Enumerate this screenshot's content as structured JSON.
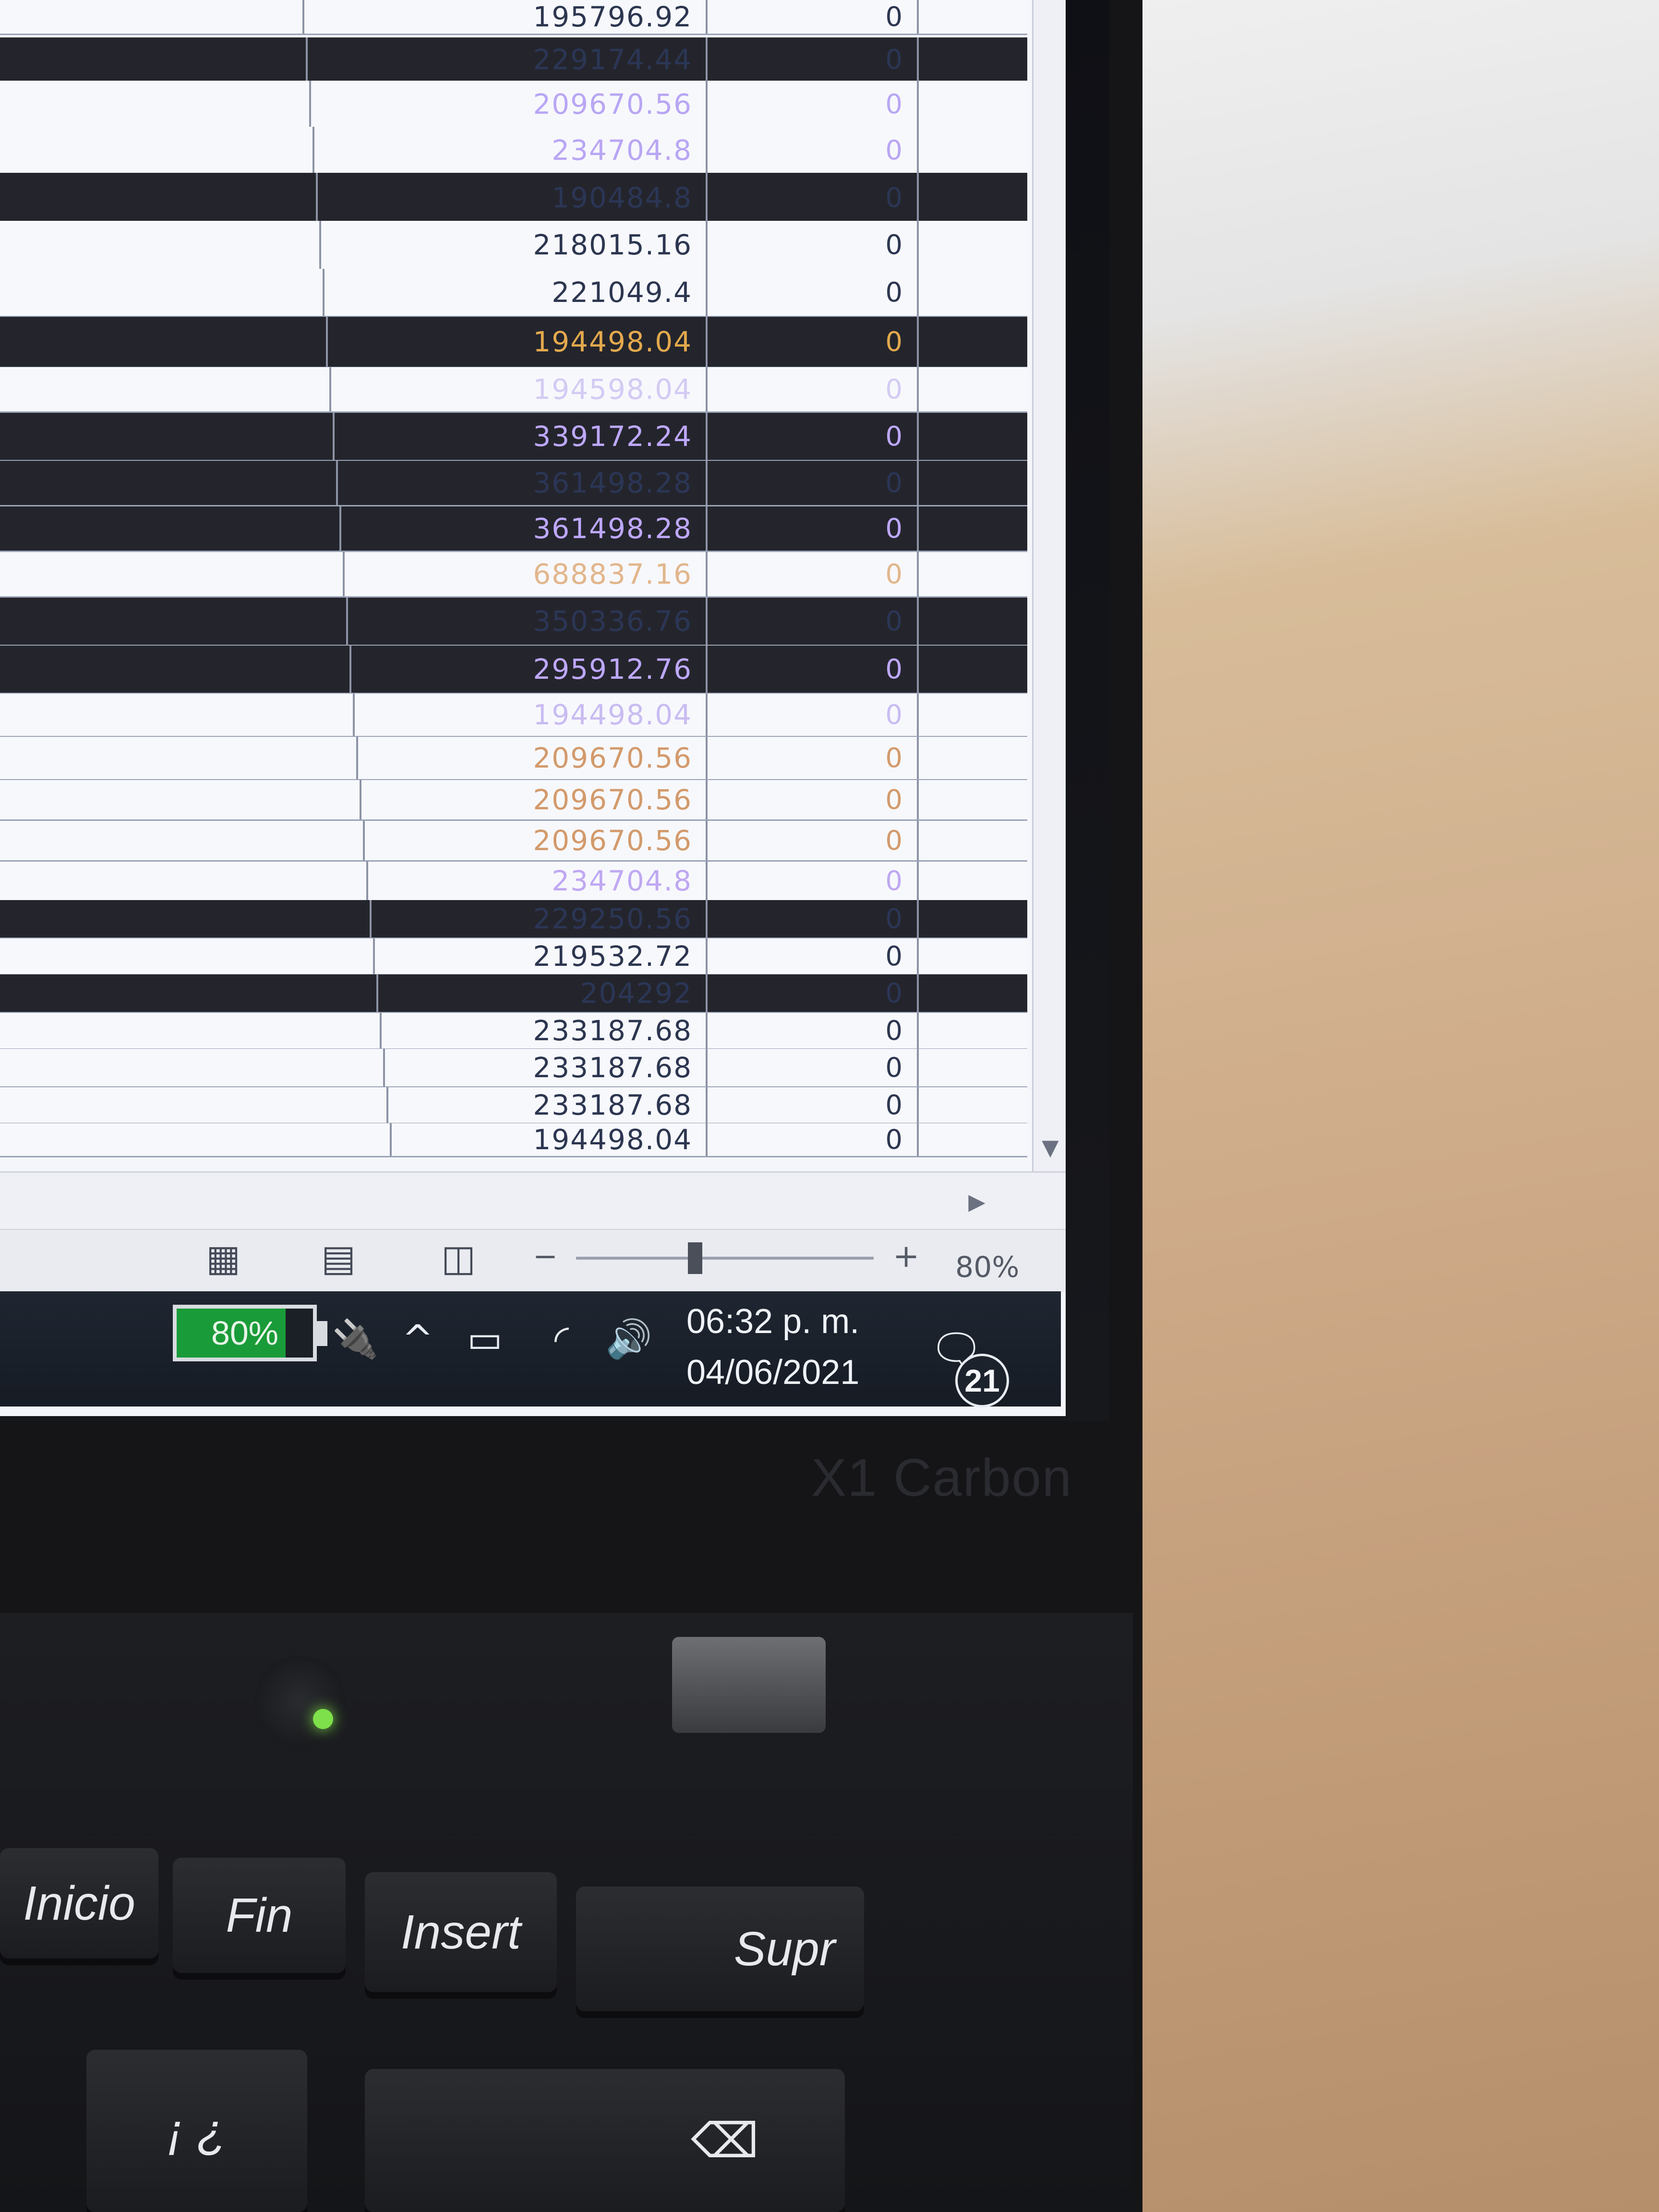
{
  "spreadsheet": {
    "rows": [
      {
        "amount": "195796.92",
        "value": "0",
        "theme": "light",
        "color": "#2c3650"
      },
      {
        "amount": "229174.44",
        "value": "0",
        "theme": "dark",
        "color": "#2b3656"
      },
      {
        "amount": "209670.56",
        "value": "0",
        "theme": "light",
        "color": "#b9a6f4"
      },
      {
        "amount": "234704.8",
        "value": "0",
        "theme": "light",
        "color": "#b9a6f4"
      },
      {
        "amount": "190484.8",
        "value": "0",
        "theme": "dark",
        "color": "#2b3656"
      },
      {
        "amount": "218015.16",
        "value": "0",
        "theme": "light",
        "color": "#2c3650"
      },
      {
        "amount": "221049.4",
        "value": "0",
        "theme": "light",
        "color": "#2c3650"
      },
      {
        "amount": "194498.04",
        "value": "0",
        "theme": "dark",
        "color": "#e3a94d"
      },
      {
        "amount": "194598.04",
        "value": "0",
        "theme": "light",
        "color": "#d3cbf3"
      },
      {
        "amount": "339172.24",
        "value": "0",
        "theme": "dark",
        "color": "#bea8ff"
      },
      {
        "amount": "361498.28",
        "value": "0",
        "theme": "dark",
        "color": "#2b3656"
      },
      {
        "amount": "361498.28",
        "value": "0",
        "theme": "dark",
        "color": "#bea8ff"
      },
      {
        "amount": "688837.16",
        "value": "0",
        "theme": "light",
        "color": "#e2b68c"
      },
      {
        "amount": "350336.76",
        "value": "0",
        "theme": "dark",
        "color": "#2b3656"
      },
      {
        "amount": "295912.76",
        "value": "0",
        "theme": "dark",
        "color": "#bea8ff"
      },
      {
        "amount": "194498.04",
        "value": "0",
        "theme": "light",
        "color": "#c9bcf2"
      },
      {
        "amount": "209670.56",
        "value": "0",
        "theme": "light",
        "color": "#d39a6c"
      },
      {
        "amount": "209670.56",
        "value": "0",
        "theme": "light",
        "color": "#d39a6c"
      },
      {
        "amount": "209670.56",
        "value": "0",
        "theme": "light",
        "color": "#d39a6c"
      },
      {
        "amount": "234704.8",
        "value": "0",
        "theme": "light",
        "color": "#bfa8f2"
      },
      {
        "amount": "229250.56",
        "value": "0",
        "theme": "dark",
        "color": "#2b3656"
      },
      {
        "amount": "219532.72",
        "value": "0",
        "theme": "light",
        "color": "#2c3650"
      },
      {
        "amount": "204292",
        "value": "0",
        "theme": "dark",
        "color": "#2b3656"
      },
      {
        "amount": "233187.68",
        "value": "0",
        "theme": "light",
        "color": "#2c3650"
      },
      {
        "amount": "233187.68",
        "value": "0",
        "theme": "light",
        "color": "#2c3650"
      },
      {
        "amount": "233187.68",
        "value": "0",
        "theme": "light",
        "color": "#2c3650"
      },
      {
        "amount": "194498.04",
        "value": "0",
        "theme": "light",
        "color": "#2c3650"
      }
    ]
  },
  "status_bar": {
    "zoom_minus": "−",
    "zoom_plus": "+",
    "zoom_label": "80%",
    "zoom_fraction": 0.4
  },
  "taskbar": {
    "battery_label": "80%",
    "battery_level": 0.8,
    "battery_color": "#1a9b39",
    "time": "06:32 p. m.",
    "date": "04/06/2021",
    "notification_count": "21",
    "icons": [
      "plug-icon",
      "chevron-up-icon",
      "battery-icon",
      "wifi-icon",
      "volume-icon",
      "notification-icon"
    ]
  },
  "laptop": {
    "model": "X1 Carbon"
  },
  "keyboard": {
    "keys": [
      "Inicio",
      "Fin",
      "Insert",
      "Supr",
      "¡ ¿"
    ]
  }
}
